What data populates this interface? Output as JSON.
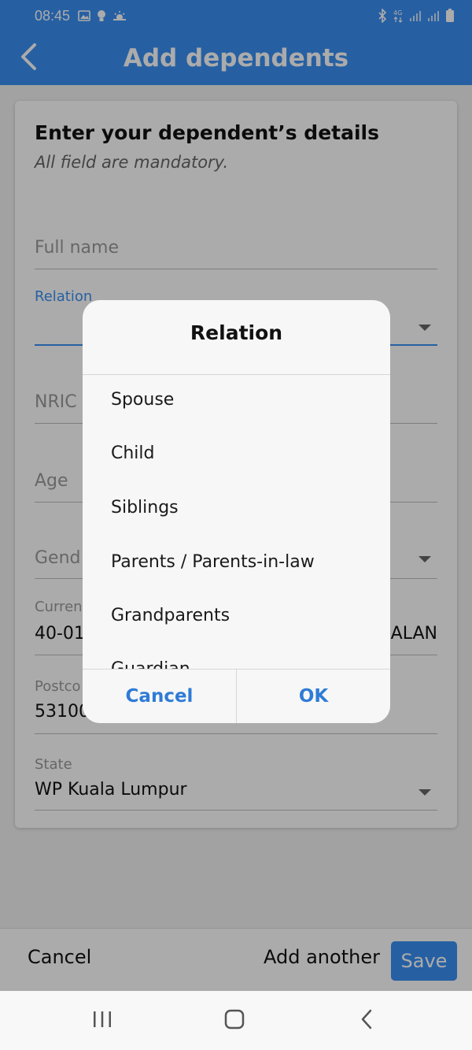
{
  "status_bar": {
    "time": "08:45",
    "left_icons": [
      "gallery-icon",
      "bulb-icon",
      "weather-icon"
    ],
    "right_icons": [
      "bluetooth-icon",
      "data-4g-icon",
      "signal-icon",
      "signal-icon",
      "battery-icon"
    ]
  },
  "app_bar": {
    "title": "Add dependents",
    "back_icon": "chevron-left-icon"
  },
  "form": {
    "heading": "Enter your dependent’s details",
    "subheading": "All field are mandatory.",
    "full_name": {
      "placeholder": "Full name"
    },
    "relation": {
      "label": "Relation"
    },
    "nric": {
      "placeholder": "NRIC"
    },
    "age": {
      "placeholder": "Age"
    },
    "gender": {
      "placeholder": "Gend"
    },
    "current_address": {
      "label": "Curren",
      "value_left": "40-01",
      "value_right": "ALAN"
    },
    "postcode": {
      "label": "Postco",
      "value": "53100"
    },
    "state": {
      "label": "State",
      "value": "WP Kuala Lumpur"
    }
  },
  "bottom_bar": {
    "cancel_label": "Cancel",
    "add_another_label": "Add another",
    "save_label": "Save"
  },
  "dialog": {
    "title": "Relation",
    "options": [
      "Spouse",
      "Child",
      "Siblings",
      "Parents / Parents-in-law",
      "Grandparents",
      "Guardian"
    ],
    "cancel_label": "Cancel",
    "ok_label": "OK"
  },
  "nav_bar": {
    "icons": [
      "recent-apps-icon",
      "home-icon",
      "back-icon"
    ]
  },
  "colors": {
    "primary": "#3a8ff3",
    "dialog_button": "#2f7bd6",
    "scrim": "rgba(0,0,0,0.33)"
  }
}
